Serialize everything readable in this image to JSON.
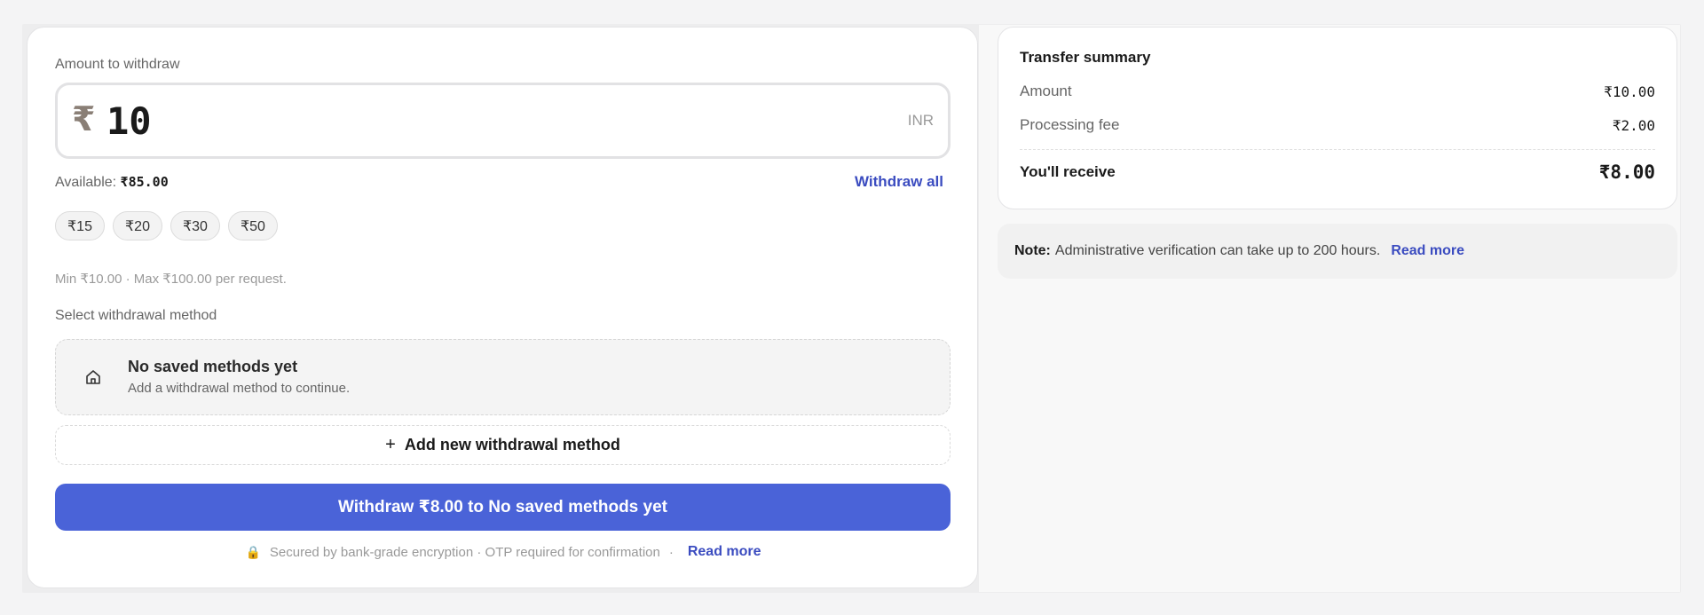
{
  "withdraw": {
    "amount_label": "Amount to withdraw",
    "currency_symbol": "₹",
    "amount_value": "10",
    "currency_code": "INR",
    "available_label": "Available:",
    "available_amount": "₹85.00",
    "withdraw_all_label": "Withdraw all",
    "quick_amounts": [
      "₹15",
      "₹20",
      "₹30",
      "₹50"
    ],
    "limits_text": "Min ₹10.00 · Max ₹100.00 per request.",
    "method_label": "Select withdrawal method",
    "empty_method_title": "No saved methods yet",
    "empty_method_subtitle": "Add a withdrawal method to continue.",
    "add_method_label": "Add new withdrawal method",
    "submit_label": "Withdraw ₹8.00 to No saved methods yet",
    "security_text": "Secured by bank-grade encryption · OTP required for confirmation",
    "security_sep": "·",
    "security_link": "Read more"
  },
  "summary": {
    "title": "Transfer summary",
    "rows": [
      {
        "label": "Amount",
        "value": "₹10.00"
      },
      {
        "label": "Processing fee",
        "value": "₹2.00"
      }
    ],
    "total_label": "You'll receive",
    "total_value": "₹8.00"
  },
  "note": {
    "prefix": "Note:",
    "text": "Administrative verification can take up to 200 hours.",
    "link": "Read more"
  },
  "colors": {
    "accent": "#4a63d8",
    "link": "#3b4cc0"
  },
  "icons": {
    "method_empty": "home-icon",
    "add": "plus-icon",
    "secure": "lock-icon"
  }
}
